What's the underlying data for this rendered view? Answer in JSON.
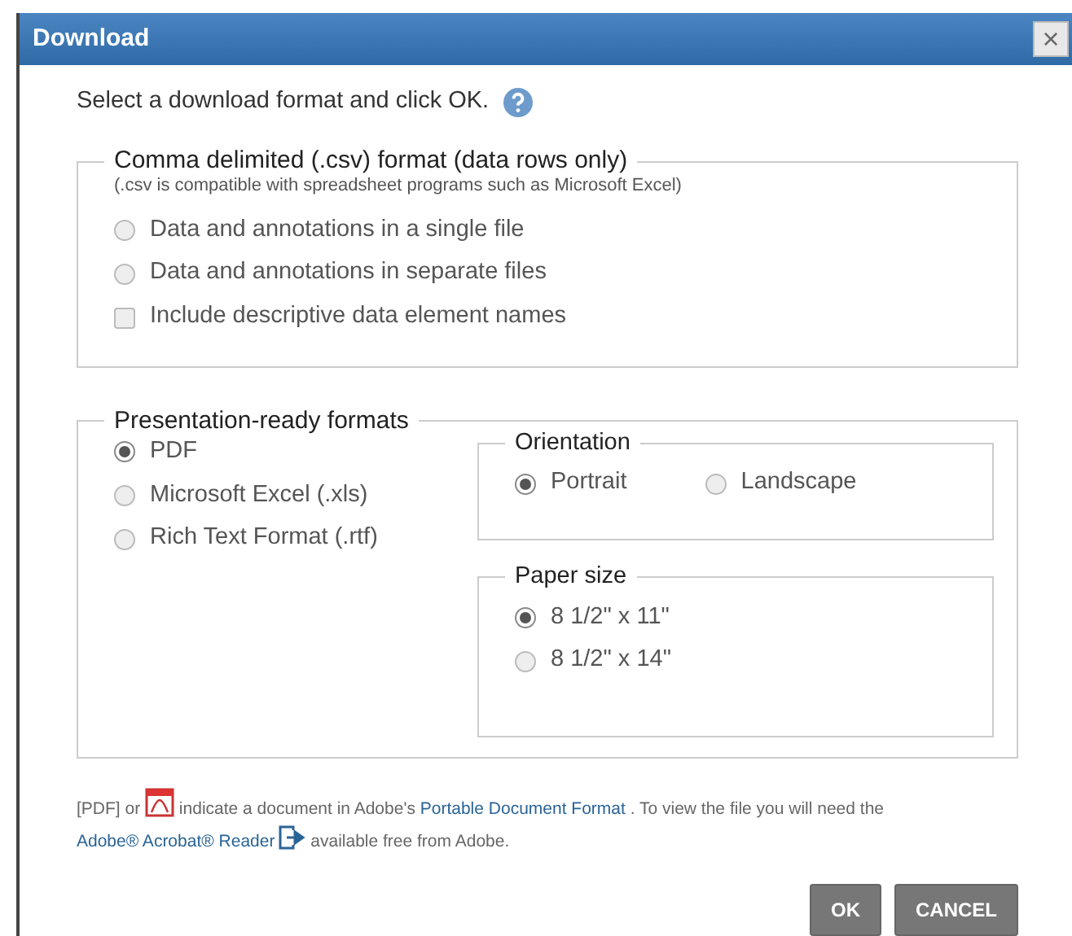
{
  "window": {
    "title": "Download",
    "close": "×"
  },
  "intro": "Select a download format and click OK.",
  "csv": {
    "legend": "Comma delimited (.csv) format (data rows only)",
    "note": "(.csv is compatible with spreadsheet programs such as Microsoft Excel)",
    "options": [
      {
        "kind": "radio",
        "label": "Data and annotations in a single file",
        "selected": false
      },
      {
        "kind": "radio",
        "label": "Data and annotations in separate files",
        "selected": false
      },
      {
        "kind": "checkbox",
        "label": "Include descriptive data element names",
        "checked": false
      }
    ]
  },
  "presentation": {
    "legend": "Presentation-ready formats",
    "formats": [
      {
        "label": "PDF",
        "selected": true
      },
      {
        "label": "Microsoft Excel (.xls)",
        "selected": false
      },
      {
        "label": "Rich Text Format (.rtf)",
        "selected": false
      }
    ],
    "orientation": {
      "legend": "Orientation",
      "options": [
        {
          "label": "Portrait",
          "selected": true
        },
        {
          "label": "Landscape",
          "selected": false
        }
      ]
    },
    "paper_size": {
      "legend": "Paper size",
      "options": [
        {
          "label": "8 1/2\" x 11\"",
          "selected": true
        },
        {
          "label": "8 1/2\" x 14\"",
          "selected": false
        }
      ]
    }
  },
  "footnote": {
    "prefix": "[PDF] or",
    "middle": "indicate a document in Adobe's",
    "link1": "Portable Document Format",
    "after_link1": ". To view the file you will need the",
    "link2": "Adobe® Acrobat® Reader",
    "suffix": "available free from Adobe."
  },
  "buttons": [
    {
      "label": "OK"
    },
    {
      "label": "CANCEL"
    }
  ]
}
